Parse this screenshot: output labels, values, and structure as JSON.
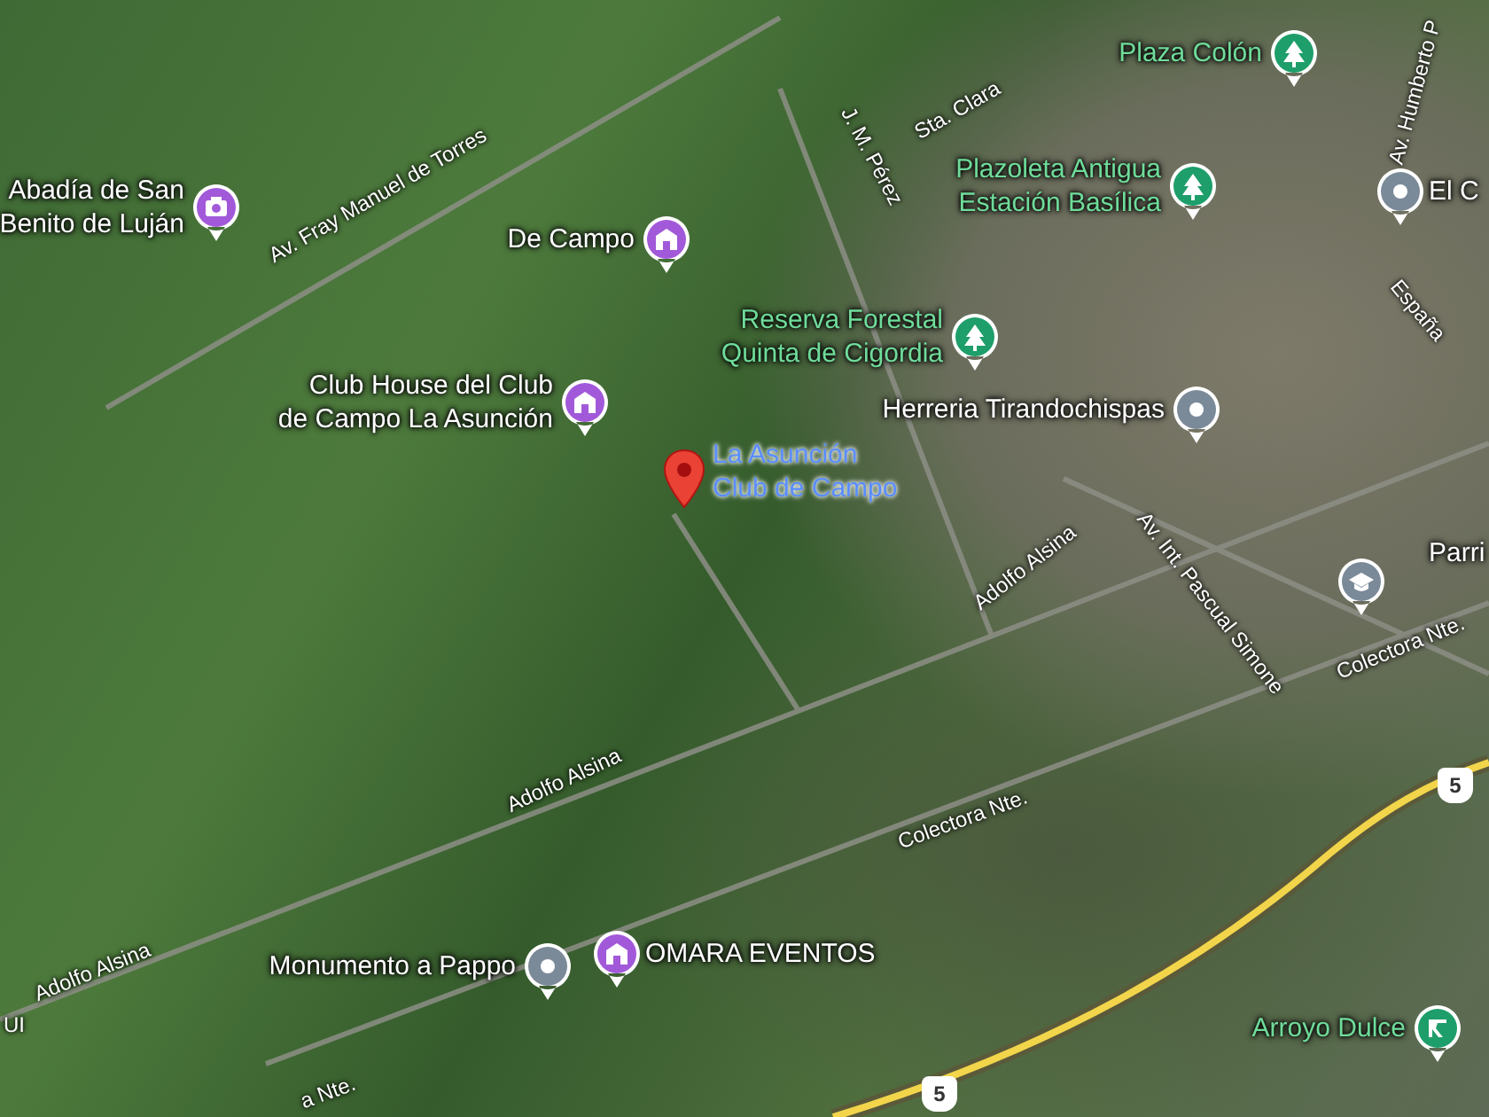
{
  "map": {
    "places": [
      {
        "name": "Abadía de San Benito de Luján",
        "kind": "attraction",
        "selected": false
      },
      {
        "name": "De Campo",
        "kind": "landmark",
        "selected": false
      },
      {
        "name": "Club House del Club de Campo La Asunción",
        "kind": "landmark",
        "selected": false
      },
      {
        "name": "La Asunción Club de Campo",
        "kind": "pin",
        "selected": true
      },
      {
        "name": "Plaza Colón",
        "kind": "park",
        "selected": false
      },
      {
        "name": "Plazoleta Antigua Estación Basílica",
        "kind": "park",
        "selected": false
      },
      {
        "name": "Reserva Forestal Quinta de Cigordia",
        "kind": "park",
        "selected": false
      },
      {
        "name": "Herreria Tirandochispas",
        "kind": "generic",
        "selected": false
      },
      {
        "name": "El C",
        "kind": "generic",
        "selected": false
      },
      {
        "name": "Parri",
        "kind": "school",
        "selected": false
      },
      {
        "name": "Monumento a Pappo",
        "kind": "generic",
        "selected": false
      },
      {
        "name": "OMARA EVENTOS",
        "kind": "landmark",
        "selected": false
      },
      {
        "name": "Arroyo Dulce",
        "kind": "station",
        "selected": false
      }
    ],
    "road_labels": [
      {
        "text": "Av. Fray Manuel de Torres"
      },
      {
        "text": "J. M. Pérez"
      },
      {
        "text": "Sta. Clara"
      },
      {
        "text": "Av. Humberto P"
      },
      {
        "text": "España"
      },
      {
        "text": "Adolfo Alsina"
      },
      {
        "text": "Av. Int. Pascual Simone"
      },
      {
        "text": "Colectora Nte."
      },
      {
        "text": "Adolfo Alsina"
      },
      {
        "text": "Colectora Nte."
      },
      {
        "text": "Adolfo Alsina"
      },
      {
        "text": "a Nte."
      },
      {
        "text": "UI"
      }
    ],
    "route_shields": [
      {
        "text": "5"
      },
      {
        "text": "5"
      }
    ]
  }
}
